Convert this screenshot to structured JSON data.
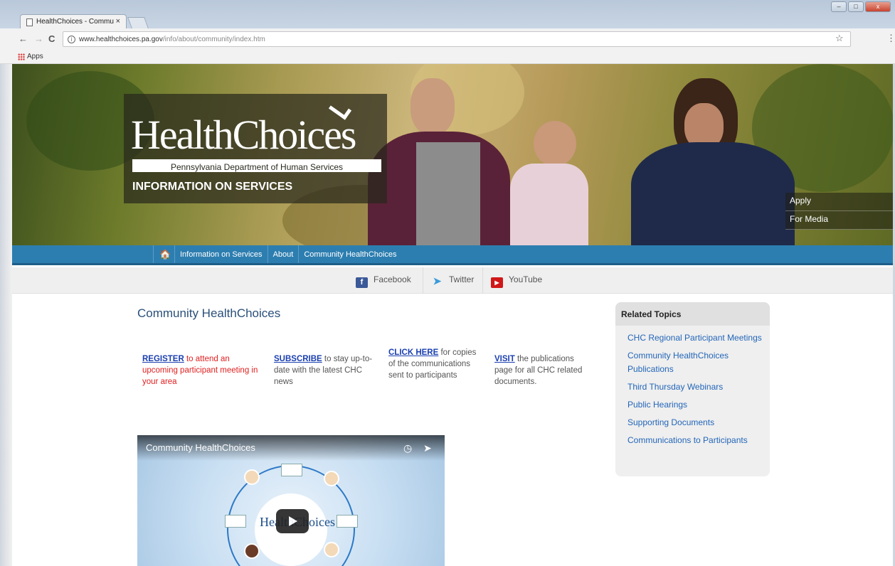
{
  "browser": {
    "tab_title": "HealthChoices - Commu",
    "tab_close": "×",
    "url_domain": "www.healthchoices.pa.gov",
    "url_path": "/info/about/community/index.htm",
    "bookmarks_label": "Apps",
    "back": "←",
    "forward": "→",
    "reload": "C",
    "info": "i",
    "star": "☆",
    "menu": "⋮",
    "win_min": "–",
    "win_max": "□",
    "win_close": "x"
  },
  "hero": {
    "logo_text": "HealthChoices",
    "logo_subtitle": "Pennsylvania Department of Human Services",
    "section_title": "INFORMATION ON SERVICES",
    "side_links": [
      "Apply",
      "For Media"
    ]
  },
  "nav": {
    "home_icon": "home-icon",
    "items": [
      "Information on Services",
      "About",
      "Community HealthChoices"
    ]
  },
  "social": {
    "facebook": "Facebook",
    "twitter": "Twitter",
    "youtube": "YouTube"
  },
  "content": {
    "title": "Community HealthChoices",
    "columns": [
      {
        "link": "REGISTER",
        "text": " to attend an upcoming participant meeting in your area"
      },
      {
        "link": "SUBSCRIBE",
        "text": " to stay up-to-date with the latest CHC news"
      },
      {
        "link": "CLICK HERE",
        "text": " for copies of the communications sent to participants"
      },
      {
        "link": "VISIT",
        "text": " the publications page for all CHC related documents."
      }
    ]
  },
  "video": {
    "title": "Community HealthChoices",
    "logo_text": "HealthChoices"
  },
  "related": {
    "heading": "Related Topics",
    "items": [
      "CHC Regional Participant Meetings",
      "Community HealthChoices Publications",
      "Third Thursday Webinars",
      "Public Hearings",
      "Supporting Documents",
      "Communications to Participants"
    ]
  },
  "colors": {
    "nav_blue": "#2d7eb0",
    "link_blue": "#1a3fb0",
    "register_red": "#e02020",
    "related_link": "#2366b8"
  }
}
